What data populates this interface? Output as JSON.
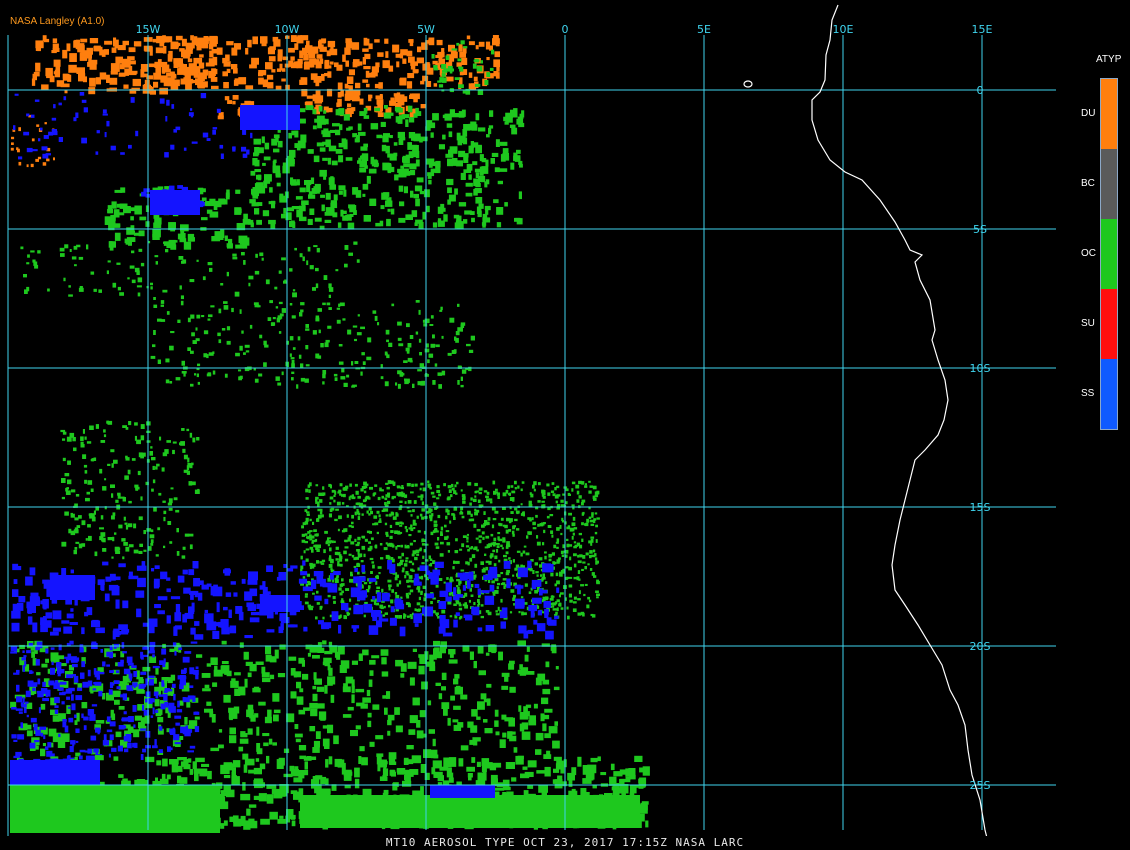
{
  "credit": "NASA Langley (A1.0)",
  "footer": "MT10  AEROSOL TYPE  OCT 23, 2017 17:15Z  NASA LARC",
  "map": {
    "lon_labels": [
      "15W",
      "10W",
      "5W",
      "0",
      "5E",
      "10E",
      "15E"
    ],
    "lat_labels": [
      "0",
      "5S",
      "10S",
      "15S",
      "20S",
      "25S"
    ],
    "grid_color": "#3fd4ee",
    "coast_color": "#ffffff"
  },
  "legend": {
    "title": "ATYP",
    "items": [
      {
        "code": "DU",
        "color": "#ff7f0e"
      },
      {
        "code": "BC",
        "color": "#5a5a5a"
      },
      {
        "code": "OC",
        "color": "#1ec81e"
      },
      {
        "code": "SU",
        "color": "#ff0f0f"
      },
      {
        "code": "SS",
        "color": "#0f5aff"
      }
    ]
  },
  "colors": {
    "dust": "#ff7f0e",
    "organic_carbon": "#1ec81e",
    "sea_salt": "#1414ff"
  }
}
